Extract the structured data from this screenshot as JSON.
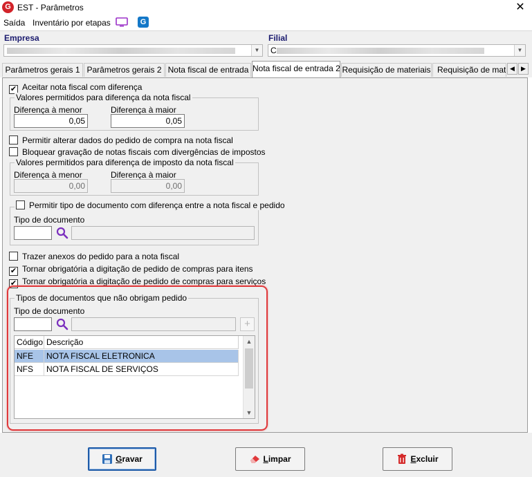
{
  "window": {
    "title": "EST - Parâmetros",
    "app_icon_letter": "G",
    "close_glyph": "✕"
  },
  "menu": {
    "items": [
      "Saída",
      "Inventário por etapas"
    ],
    "icons": [
      "monitor-icon",
      "g-app-icon"
    ]
  },
  "header": {
    "empresa_label": "Empresa",
    "filial_label": "Filial",
    "filial_value_prefix": "C"
  },
  "tabs": [
    {
      "label": "Parâmetros gerais 1",
      "active": false
    },
    {
      "label": "Parâmetros gerais 2",
      "active": false
    },
    {
      "label": "Nota fiscal de entrada",
      "active": false
    },
    {
      "label": "Nota fiscal de entrada 2",
      "active": true
    },
    {
      "label": "Requisição de materiais",
      "active": false
    },
    {
      "label": "Requisição de materi",
      "active": false
    }
  ],
  "form": {
    "aceitar_nf_diferenca": {
      "label": "Aceitar nota fiscal com diferença",
      "checked": true
    },
    "valores_nf": {
      "legend": "Valores permitidos para diferença da nota fiscal",
      "dif_menor_label": "Diferença à menor",
      "dif_menor_value": "0,05",
      "dif_maior_label": "Diferença à maior",
      "dif_maior_value": "0,05"
    },
    "permitir_alterar_pedido": {
      "label": "Permitir alterar dados do pedido de compra na nota fiscal",
      "checked": false
    },
    "bloquear_gravacao": {
      "label": "Bloquear gravação de notas fiscais com divergências de impostos",
      "checked": false
    },
    "valores_imposto": {
      "legend": "Valores permitidos para diferença de imposto da nota fiscal",
      "dif_menor_label": "Diferença à menor",
      "dif_menor_value": "0,00",
      "dif_maior_label": "Diferença à maior",
      "dif_maior_value": "0,00"
    },
    "permitir_tipo_doc": {
      "label": "Permitir tipo de documento com diferença entre a nota fiscal e pedido",
      "checked": false,
      "tipo_doc_label": "Tipo de documento"
    },
    "trazer_anexos": {
      "label": "Trazer anexos do pedido para a nota fiscal",
      "checked": false
    },
    "obrigatoria_itens": {
      "label": "Tornar obrigatória a digitação de pedido de compras para itens",
      "checked": true
    },
    "obrigatoria_servicos": {
      "label": "Tornar obrigatória a digitação de pedido de compras para serviços",
      "checked": true
    },
    "tipos_nao_obrigam": {
      "legend": "Tipos de documentos que não obrigam pedido",
      "tipo_doc_label": "Tipo de documento",
      "plus_glyph": "+",
      "grid": {
        "columns": [
          "Código",
          "Descrição"
        ],
        "rows": [
          {
            "codigo": "NFE",
            "descricao": "NOTA FISCAL ELETRONICA",
            "selected": true
          },
          {
            "codigo": "NFS",
            "descricao": "NOTA  FISCAL DE SERVIÇOS",
            "selected": false
          }
        ]
      }
    }
  },
  "buttons": {
    "gravar": {
      "label": "Gravar",
      "underline": "G",
      "rest": "ravar"
    },
    "limpar": {
      "label": "Limpar",
      "underline": "L",
      "rest": "impar"
    },
    "excluir": {
      "label": "Excluir",
      "underline": "E",
      "rest": "xcluir"
    }
  },
  "colors": {
    "highlight": "#e0393b",
    "selection": "#a8c4e8",
    "header_label": "#1a1a6e",
    "search_icon": "#7b2fbe"
  }
}
